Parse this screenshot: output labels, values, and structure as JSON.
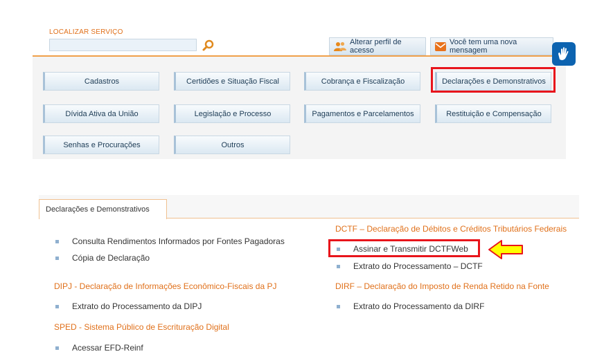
{
  "search": {
    "label": "LOCALIZAR SERVIÇO",
    "value": "",
    "placeholder": ""
  },
  "header": {
    "profile_label": "Alterar perfil de acesso",
    "message_label": "Você tem uma nova mensagem"
  },
  "categories": [
    "Cadastros",
    "Certidões e Situação Fiscal",
    "Cobrança e Fiscalização",
    "Declarações e Demonstrativos",
    "Dívida Ativa da União",
    "Legislação e Processo",
    "Pagamentos e Parcelamentos",
    "Restituição e Compensação",
    "Senhas e Procurações",
    "Outros"
  ],
  "active_tab": "Declarações e Demonstrativos",
  "left_column": {
    "items_top": [
      "Consulta Rendimentos Informados por Fontes Pagadoras",
      "Cópia de Declaração"
    ],
    "dipj_title": "DIPJ - Declaração de Informações Econômico-Fiscais da PJ",
    "dipj_items": [
      "Extrato do Processamento da DIPJ"
    ],
    "sped_title": "SPED - Sistema Público de Escrituração Digital",
    "sped_items": [
      "Acessar EFD-Reinf"
    ]
  },
  "right_column": {
    "dctf_title": "DCTF – Declaração de Débitos e Créditos Tributários Federais",
    "dctf_items": [
      "Assinar e Transmitir DCTFWeb",
      "Extrato do Processamento – DCTF"
    ],
    "dirf_title": "DIRF – Declaração do Imposto de Renda Retido na Fonte",
    "dirf_items": [
      "Extrato do Processamento da DIRF"
    ]
  },
  "colors": {
    "accent": "#e0701a",
    "highlight": "#e8141b",
    "arrow": "#ffff00",
    "libras_bg": "#0c63b0"
  }
}
